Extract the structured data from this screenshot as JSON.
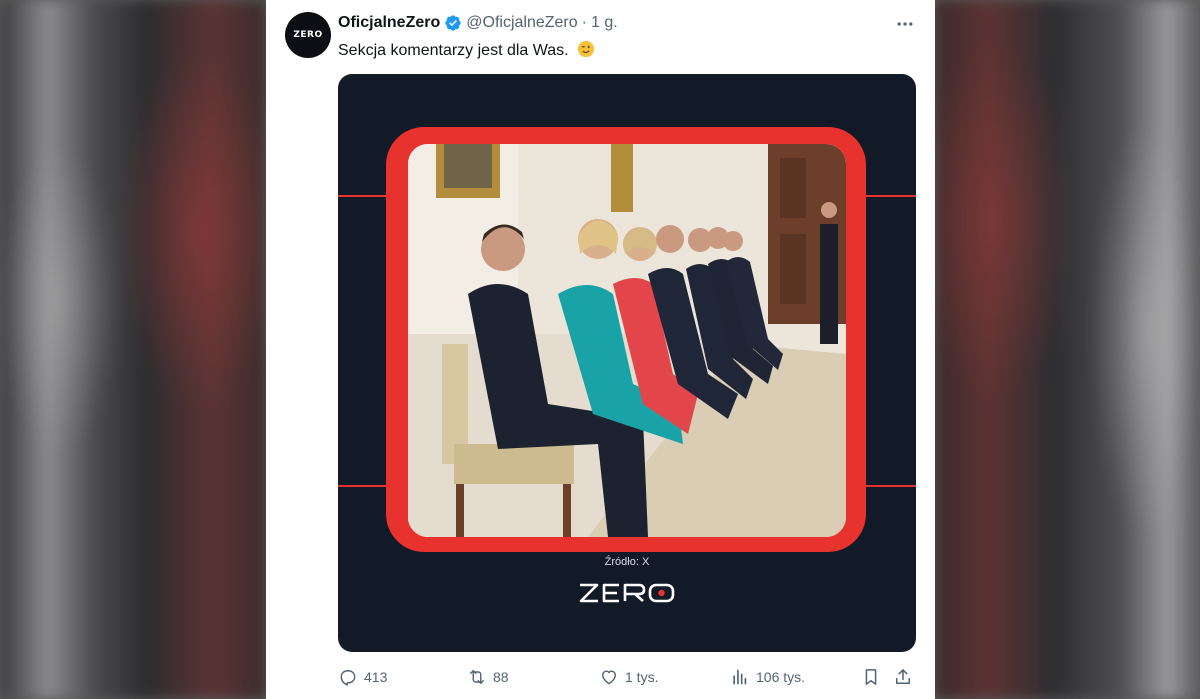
{
  "tweet": {
    "display_name": "OficjalneZero",
    "handle": "@OficjalneZero",
    "separator": "·",
    "time": "1 g.",
    "text": "Sekcja komentarzy jest dla Was.",
    "avatar_label": "ZERO",
    "more_icon": "more-dots-icon",
    "verified_icon": "verified-badge-icon",
    "emoji_icon": "winking-face-emoji"
  },
  "media": {
    "caption": "Źródło: X",
    "logo_text": "ZERO",
    "colors": {
      "background": "#121a28",
      "frame": "#e8322d"
    }
  },
  "actions": {
    "replies": "413",
    "reposts": "88",
    "likes": "1 tys.",
    "views": "106 tys.",
    "icons": [
      "reply-icon",
      "repost-icon",
      "like-icon",
      "views-icon",
      "bookmark-icon",
      "share-icon"
    ]
  },
  "colors": {
    "text_primary": "#0f1419",
    "text_secondary": "#536471",
    "verified": "#1d9bf0"
  }
}
